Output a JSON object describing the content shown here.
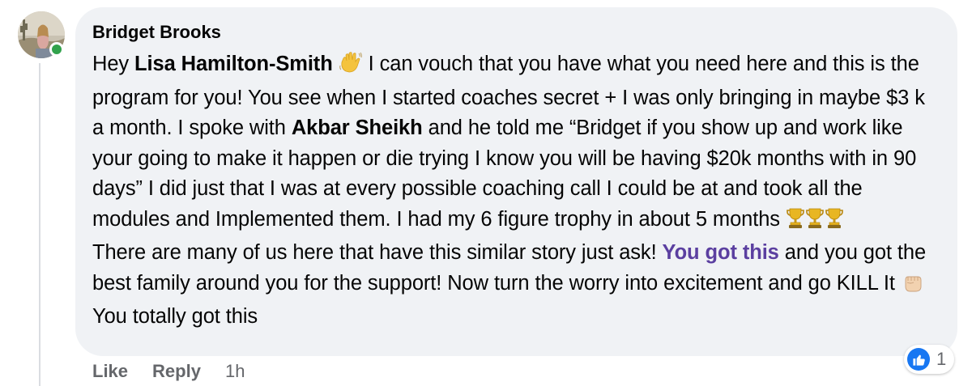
{
  "comment": {
    "author": "Bridget Brooks",
    "paragraphs": [
      [
        {
          "t": "text",
          "v": "Hey "
        },
        {
          "t": "mention",
          "v": "Lisa Hamilton-Smith"
        },
        {
          "t": "text",
          "v": " "
        },
        {
          "t": "icon",
          "icon": "waving-hand"
        },
        {
          "t": "text",
          "v": " I can vouch that you have what you need here and this is the program for you! You see when I started coaches secret + I was only bringing in maybe $3 k a month. I spoke with "
        },
        {
          "t": "mention",
          "v": "Akbar Sheikh"
        },
        {
          "t": "text",
          "v": " and he told me “Bridget if you show up and work like your going to make it happen or die trying I know you will be having $20k months with in 90 days” I did just that I was at every possible coaching call I could be at and took all the modules and Implemented them. I had my 6 figure trophy in about 5 months "
        },
        {
          "t": "icon",
          "icon": "trophy"
        },
        {
          "t": "icon",
          "icon": "trophy"
        },
        {
          "t": "icon",
          "icon": "trophy"
        }
      ],
      [
        {
          "t": "text",
          "v": "There are many of us here that have this similar story just ask! "
        },
        {
          "t": "link",
          "v": "You got this"
        },
        {
          "t": "text",
          "v": " and you got the best family around you for the support! Now turn the worry into excitement and go KILL It "
        },
        {
          "t": "icon",
          "icon": "raised-fist"
        },
        {
          "t": "text",
          "v": " You totally got this"
        }
      ]
    ],
    "reactions": {
      "icon": "like-thumb",
      "count": "1"
    },
    "actions": {
      "like": "Like",
      "reply": "Reply",
      "time": "1h"
    }
  },
  "colors": {
    "bubble": "#f0f2f5",
    "text": "#050505",
    "muted": "#65676b",
    "link": "#5b3fa0",
    "like_blue": "#1877f2",
    "online_green": "#31a24c"
  }
}
